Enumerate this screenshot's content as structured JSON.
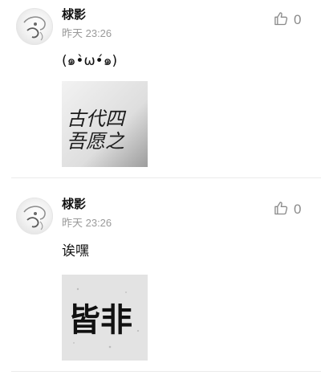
{
  "comments": [
    {
      "username": "梂影",
      "time": "昨天 23:26",
      "text": "(๑•̀ω•́๑)",
      "like_count": "0",
      "image_text": "古代四 吾愿之"
    },
    {
      "username": "梂影",
      "time": "昨天 23:26",
      "text": "诶嘿",
      "like_count": "0",
      "image_text": "皆非"
    }
  ],
  "icons": {
    "like": "thumbs-up-outline-icon"
  },
  "colors": {
    "username": "#111111",
    "time": "#9a9a9a",
    "like": "#8a8a8a",
    "divider": "#eaeaea"
  }
}
